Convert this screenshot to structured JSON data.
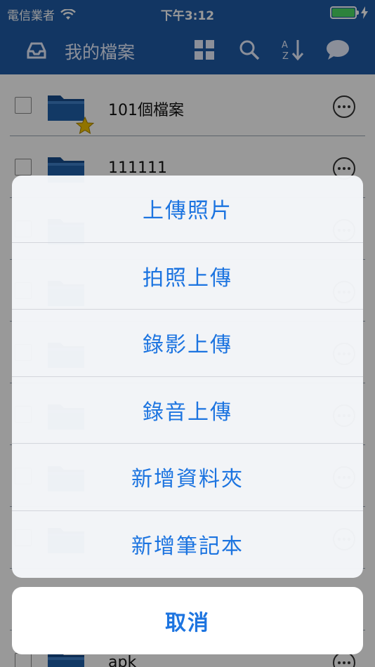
{
  "status": {
    "carrier": "電信業者",
    "time": "下午3:12"
  },
  "nav": {
    "title": "我的檔案"
  },
  "files": [
    {
      "name": "101個檔案",
      "starred": true
    },
    {
      "name": "111111",
      "starred": false
    },
    {
      "name": "",
      "starred": false
    },
    {
      "name": "",
      "starred": false
    },
    {
      "name": "",
      "starred": false
    },
    {
      "name": "",
      "starred": false
    },
    {
      "name": "",
      "starred": false
    },
    {
      "name": "",
      "starred": false
    },
    {
      "name": "",
      "starred": false
    },
    {
      "name": "apk",
      "starred": false
    }
  ],
  "sheet": {
    "items": [
      "上傳照片",
      "拍照上傳",
      "錄影上傳",
      "錄音上傳",
      "新增資料夾",
      "新增筆記本"
    ],
    "cancel": "取消"
  },
  "colors": {
    "nav": "#1f5aa6",
    "accent": "#1c74e0",
    "folder": "#1e5fa8",
    "star": "#f2c200"
  }
}
